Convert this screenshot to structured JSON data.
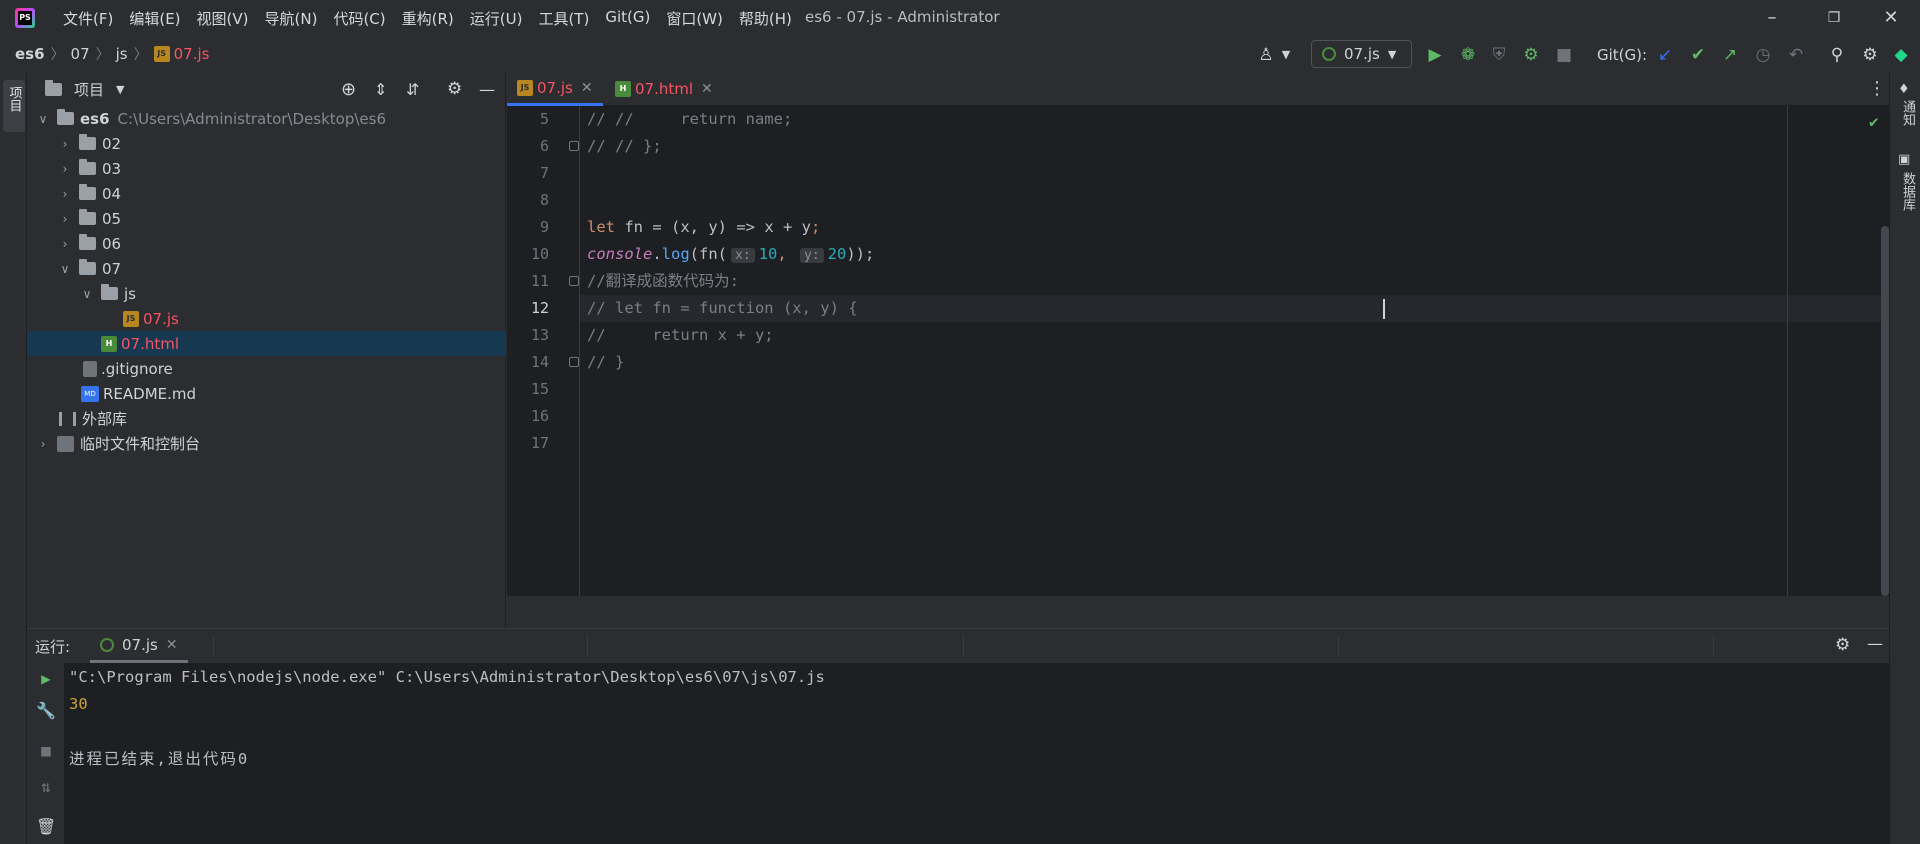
{
  "title_bar": {
    "menu": [
      "文件(F)",
      "编辑(E)",
      "视图(V)",
      "导航(N)",
      "代码(C)",
      "重构(R)",
      "运行(U)",
      "工具(T)",
      "Git(G)",
      "窗口(W)",
      "帮助(H)"
    ],
    "window_title": "es6 - 07.js - Administrator"
  },
  "breadcrumb": {
    "items": [
      "es6",
      "07",
      "js",
      "07.js"
    ]
  },
  "toolbar": {
    "run_config": "07.js",
    "git_label": "Git(G):"
  },
  "left_strip": {
    "project_label": "项目"
  },
  "project": {
    "title": "项目",
    "root_name": "es6",
    "root_path": "C:\\Users\\Administrator\\Desktop\\es6",
    "folders": [
      "02",
      "03",
      "04",
      "05",
      "06",
      "07"
    ],
    "js_folder": "js",
    "file_js": "07.js",
    "file_html": "07.html",
    "gitignore": ".gitignore",
    "readme": "README.md",
    "ext_libs": "外部库",
    "scratches": "临时文件和控制台"
  },
  "editor": {
    "tabs": [
      {
        "label": "07.js",
        "type": "js"
      },
      {
        "label": "07.html",
        "type": "html"
      }
    ],
    "line_numbers": [
      "5",
      "6",
      "7",
      "8",
      "9",
      "10",
      "11",
      "12",
      "13",
      "14",
      "15",
      "16",
      "17"
    ],
    "current_line": "12",
    "code": {
      "l5": "// //     return name;",
      "l6": "// // };",
      "l9_kw": "let",
      "l9_name": "fn",
      "l9_rest": " = (x, y) => x + y",
      "l9_semi": ";",
      "l10_obj": "console",
      "l10_dot": ".",
      "l10_fn": "log",
      "l10_open": "(fn(",
      "l10_hint_x": "x:",
      "l10_x": "10",
      "l10_comma": ",",
      "l10_hint_y": "y:",
      "l10_y": "20",
      "l10_close": "));",
      "l11": "//翻译成函数代码为:",
      "l12": "// let fn = function (x, y) {",
      "l13": "//     return x + y;",
      "l14": "// }"
    }
  },
  "right_strip": {
    "notifications": "通知",
    "database": "数据库"
  },
  "run_panel": {
    "label": "运行:",
    "tab": "07.js",
    "command": "\"C:\\Program Files\\nodejs\\node.exe\" C:\\Users\\Administrator\\Desktop\\es6\\07\\js\\07.js",
    "output": "30",
    "exit_message": "进程已结束,退出代码0"
  },
  "colors": {
    "accent": "#3574f0",
    "run_green": "#5fb865",
    "error_red": "#f75464"
  }
}
